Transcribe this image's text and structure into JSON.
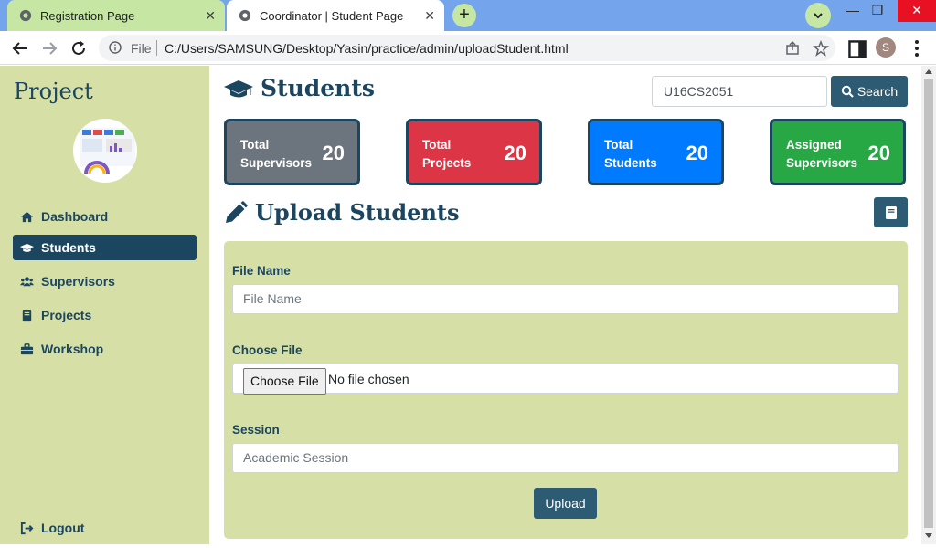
{
  "browser": {
    "tabs": [
      {
        "title": "Registration Page",
        "active": false
      },
      {
        "title": "Coordinator | Student Page",
        "active": true
      }
    ],
    "address": {
      "scheme_label": "File",
      "url": "C:/Users/SAMSUNG/Desktop/Yasin/practice/admin/uploadStudent.html"
    },
    "profile_initial": "S",
    "colors": {
      "tabbar": "#73a4ec",
      "inactive_tab": "#c6e6a4",
      "close": "#e81123"
    }
  },
  "sidebar": {
    "brand": "Project",
    "items": [
      {
        "label": "Dashboard",
        "icon": "home-icon",
        "active": false
      },
      {
        "label": "Students",
        "icon": "graduation-cap-icon",
        "active": true
      },
      {
        "label": "Supervisors",
        "icon": "users-icon",
        "active": false
      },
      {
        "label": "Projects",
        "icon": "book-icon",
        "active": false
      },
      {
        "label": "Workshop",
        "icon": "briefcase-icon",
        "active": false
      }
    ],
    "logout_label": "Logout",
    "colors": {
      "background": "#d6e0a6",
      "text": "#1c4660",
      "active_bg": "#1c4660"
    }
  },
  "header": {
    "title": "Students",
    "search": {
      "value": "U16CS2051",
      "button_label": "Search"
    }
  },
  "stats": [
    {
      "label": "Total Supervisors",
      "value": "20",
      "color": "#6c757d"
    },
    {
      "label": "Total Projects",
      "value": "20",
      "color": "#dc3545"
    },
    {
      "label": "Total Students",
      "value": "20",
      "color": "#007bff"
    },
    {
      "label": "Assigned Supervisors",
      "value": "20",
      "color": "#28a745"
    }
  ],
  "upload": {
    "title": "Upload Students",
    "file_name": {
      "label": "File Name",
      "placeholder": "File Name"
    },
    "choose_file": {
      "label": "Choose File",
      "button_label": "Choose File",
      "status": "No file chosen"
    },
    "session": {
      "label": "Session",
      "placeholder": "Academic Session"
    },
    "submit_label": "Upload"
  }
}
